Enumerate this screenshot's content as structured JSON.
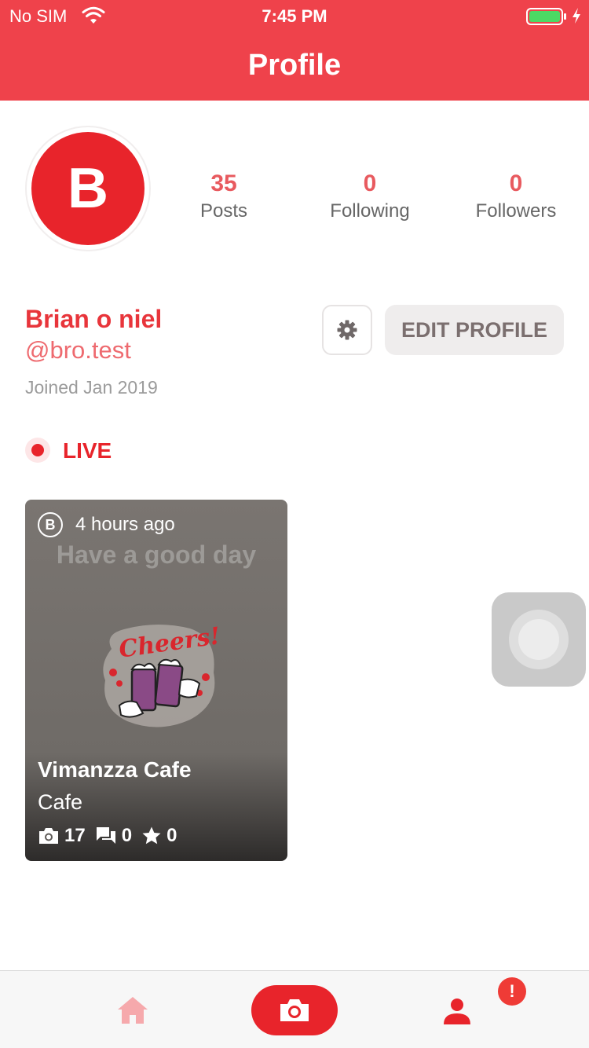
{
  "status_bar": {
    "carrier": "No SIM",
    "time": "7:45 PM"
  },
  "header": {
    "title": "Profile"
  },
  "profile": {
    "avatar_initial": "B",
    "name": "Brian o niel",
    "handle": "@bro.test",
    "joined": "Joined Jan 2019",
    "edit_label": "EDIT PROFILE"
  },
  "stats": [
    {
      "value": "35",
      "label": "Posts"
    },
    {
      "value": "0",
      "label": "Following"
    },
    {
      "value": "0",
      "label": "Followers"
    }
  ],
  "live": {
    "label": "LIVE"
  },
  "card": {
    "avatar_initial": "B",
    "time": "4 hours ago",
    "caption": "Have a good day",
    "place": "Vimanzza Cafe",
    "category": "Cafe",
    "photo_count": "17",
    "comment_count": "0",
    "star_count": "0"
  },
  "tab_bar": {
    "alert_badge": "!"
  },
  "icons": {
    "wifi": "wifi-icon",
    "battery": "battery-icon",
    "settings": "gear-icon",
    "camera": "camera-icon",
    "comment": "comment-icon",
    "star": "star-icon",
    "home": "home-icon",
    "profile": "person-icon"
  },
  "colors": {
    "brand": "#ef424b",
    "avatar": "#e8242b",
    "accent_text": "#e85a5f"
  }
}
